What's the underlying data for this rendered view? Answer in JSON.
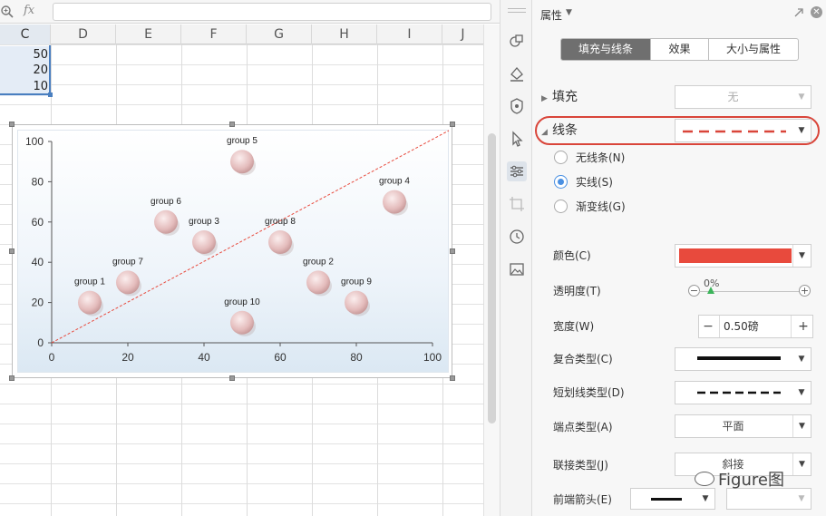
{
  "formula_bar": {
    "fx_label": "fx",
    "zoom_icon": "zoom-magnifier-icon",
    "value": ""
  },
  "sheet": {
    "columns": [
      "C",
      "D",
      "E",
      "F",
      "G",
      "H",
      "I",
      "J"
    ],
    "selected_column": "C",
    "cells": [
      "50",
      "20",
      "10"
    ],
    "selection_color": "#4a7fc0"
  },
  "chart_data": {
    "type": "scatter",
    "title": "",
    "xlabel": "",
    "ylabel": "",
    "xlim": [
      0,
      100
    ],
    "ylim": [
      0,
      100
    ],
    "x_ticks": [
      "0",
      "20",
      "40",
      "60",
      "80",
      "100"
    ],
    "y_ticks": [
      "0",
      "20",
      "40",
      "60",
      "80",
      "100"
    ],
    "points": [
      {
        "label": "group 1",
        "x": 10,
        "y": 20
      },
      {
        "label": "group 7",
        "x": 20,
        "y": 30
      },
      {
        "label": "group 6",
        "x": 30,
        "y": 60
      },
      {
        "label": "group 3",
        "x": 40,
        "y": 50
      },
      {
        "label": "group 5",
        "x": 50,
        "y": 90
      },
      {
        "label": "group 10",
        "x": 50,
        "y": 10
      },
      {
        "label": "group 8",
        "x": 60,
        "y": 50
      },
      {
        "label": "group 2",
        "x": 70,
        "y": 30
      },
      {
        "label": "group 9",
        "x": 80,
        "y": 20
      },
      {
        "label": "group 4",
        "x": 90,
        "y": 70
      }
    ],
    "trendline": {
      "from": [
        0,
        0
      ],
      "to": [
        100,
        100
      ],
      "style": "dashed",
      "color": "#e84a3d"
    },
    "bubble_color": "#e7c3c3",
    "grid": false
  },
  "strip": {
    "icons": [
      "shapes-icon",
      "fill-bucket-icon",
      "shield-icon",
      "cursor-icon",
      "settings-sliders-icon",
      "crop-icon",
      "history-icon",
      "image-icon"
    ]
  },
  "panel": {
    "title": "属性",
    "tabs": [
      "填充与线条",
      "效果",
      "大小与属性"
    ],
    "active_tab": 0,
    "fill": {
      "label": "填充",
      "value": "无"
    },
    "line": {
      "label": "线条"
    },
    "line_options": [
      "无线条(N)",
      "实线(S)",
      "渐变线(G)"
    ],
    "line_selected": 1,
    "color": {
      "label": "颜色(C)",
      "value": "#e84a3d"
    },
    "transparency": {
      "label": "透明度(T)",
      "value": "0%"
    },
    "width": {
      "label": "宽度(W)",
      "value": "0.50磅",
      "minus": "−",
      "plus": "+"
    },
    "compound": {
      "label": "复合类型(C)"
    },
    "dash": {
      "label": "短划线类型(D)"
    },
    "cap": {
      "label": "端点类型(A)",
      "value": "平面"
    },
    "join": {
      "label": "联接类型(J)",
      "value": "斜接"
    },
    "arrow": {
      "label": "前端箭头(E)"
    },
    "highlight_color": "#d9453a"
  },
  "watermark": {
    "text": "Figure图"
  }
}
